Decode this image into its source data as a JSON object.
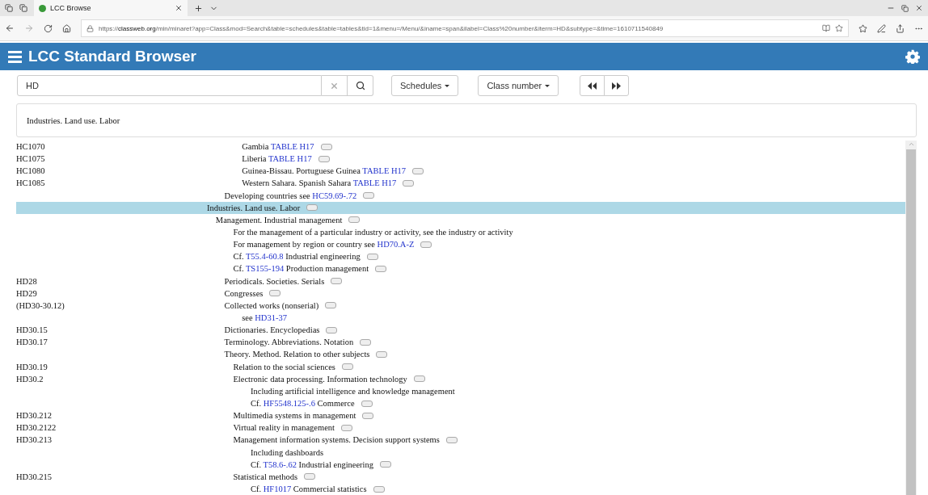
{
  "browser": {
    "tab_title": "LCC Browse",
    "url_prefix": "https://",
    "url_domain": "classweb.org",
    "url_rest": "/min/minaret?app=Class&mod=Search&table=schedules&table=tables&tid=1&menu=/Menu/&iname=span&ilabel=Class%20number&iterm=HD&subtype=&time=1610711540849"
  },
  "header": {
    "title": "LCC Standard Browser"
  },
  "search": {
    "value": "HD"
  },
  "dropdowns": [
    {
      "label": "Schedules"
    },
    {
      "label": "Class number"
    }
  ],
  "caption": "Industries. Land use. Labor",
  "entries": [
    {
      "children": [
        {
          "children": [
            {
              "children": [
                {
                  "children": [
                    {
                      "number": "HC1070",
                      "parts": [
                        {
                          "kind": "text",
                          "text": "Gambia "
                        },
                        {
                          "kind": "link",
                          "text": "TABLE H17"
                        }
                      ],
                      "note": true,
                      "selected": false
                    },
                    {
                      "number": "HC1075",
                      "parts": [
                        {
                          "kind": "text",
                          "text": "Liberia "
                        },
                        {
                          "kind": "link",
                          "text": "TABLE H17"
                        }
                      ],
                      "note": true,
                      "selected": false
                    },
                    {
                      "number": "HC1080",
                      "parts": [
                        {
                          "kind": "text",
                          "text": "Guinea-Bissau. Portuguese Guinea "
                        },
                        {
                          "kind": "link",
                          "text": "TABLE H17"
                        }
                      ],
                      "note": true,
                      "selected": false
                    },
                    {
                      "number": "HC1085",
                      "parts": [
                        {
                          "kind": "text",
                          "text": "Western Sahara. Spanish Sahara "
                        },
                        {
                          "kind": "link",
                          "text": "TABLE H17"
                        }
                      ],
                      "note": true,
                      "selected": false
                    }
                  ]
                }
              ]
            },
            {
              "parts": [
                {
                  "kind": "text",
                  "text": "Developing countries see "
                },
                {
                  "kind": "link",
                  "text": "HC59.69-.72"
                }
              ],
              "note": true,
              "selected": false
            }
          ]
        }
      ]
    },
    {
      "parts": [
        {
          "kind": "text",
          "text": "Industries. Land use. Labor"
        }
      ],
      "note": true,
      "selected": true,
      "children": [
        {
          "parts": [
            {
              "kind": "text",
              "text": "Management. Industrial management"
            }
          ],
          "note": true,
          "selected": false,
          "children": [
            {
              "children": [
                {
                  "parts": [
                    {
                      "kind": "text",
                      "text": "For the management of a particular industry or activity, see the industry or activity"
                    }
                  ],
                  "note": false,
                  "selected": false
                },
                {
                  "parts": [
                    {
                      "kind": "text",
                      "text": "For management by region or country see "
                    },
                    {
                      "kind": "link",
                      "text": "HD70.A-Z"
                    }
                  ],
                  "note": true,
                  "selected": false
                },
                {
                  "parts": [
                    {
                      "kind": "text",
                      "text": "Cf. "
                    },
                    {
                      "kind": "link",
                      "text": "T55.4-60.8"
                    },
                    {
                      "kind": "text",
                      "text": " Industrial engineering"
                    }
                  ],
                  "note": true,
                  "selected": false
                },
                {
                  "parts": [
                    {
                      "kind": "text",
                      "text": "Cf. "
                    },
                    {
                      "kind": "link",
                      "text": "TS155-194"
                    },
                    {
                      "kind": "text",
                      "text": " Production management"
                    }
                  ],
                  "note": true,
                  "selected": false
                }
              ]
            },
            {
              "number": "HD28",
              "parts": [
                {
                  "kind": "text",
                  "text": "Periodicals. Societies. Serials"
                }
              ],
              "note": true,
              "selected": false
            },
            {
              "number": "HD29",
              "parts": [
                {
                  "kind": "text",
                  "text": "Congresses"
                }
              ],
              "note": true,
              "selected": false
            },
            {
              "number": "(HD30-30.12)",
              "parts": [
                {
                  "kind": "text",
                  "text": "Collected works (nonserial)"
                }
              ],
              "note": true,
              "selected": false,
              "children": [
                {
                  "children": [
                    {
                      "parts": [
                        {
                          "kind": "text",
                          "text": "see "
                        },
                        {
                          "kind": "link",
                          "text": "HD31-37"
                        }
                      ],
                      "note": false,
                      "selected": false
                    }
                  ]
                }
              ]
            },
            {
              "number": "HD30.15",
              "parts": [
                {
                  "kind": "text",
                  "text": "Dictionaries. Encyclopedias"
                }
              ],
              "note": true,
              "selected": false
            },
            {
              "number": "HD30.17",
              "parts": [
                {
                  "kind": "text",
                  "text": "Terminology. Abbreviations. Notation"
                }
              ],
              "note": true,
              "selected": false
            },
            {
              "parts": [
                {
                  "kind": "text",
                  "text": "Theory. Method. Relation to other subjects"
                }
              ],
              "note": true,
              "selected": false,
              "children": [
                {
                  "number": "HD30.19",
                  "parts": [
                    {
                      "kind": "text",
                      "text": "Relation to the social sciences"
                    }
                  ],
                  "note": true,
                  "selected": false
                },
                {
                  "number": "HD30.2",
                  "parts": [
                    {
                      "kind": "text",
                      "text": "Electronic data processing. Information technology"
                    }
                  ],
                  "note": true,
                  "selected": false,
                  "children": [
                    {
                      "children": [
                        {
                          "parts": [
                            {
                              "kind": "text",
                              "text": "Including artificial intelligence and knowledge management"
                            }
                          ],
                          "note": false,
                          "selected": false
                        },
                        {
                          "parts": [
                            {
                              "kind": "text",
                              "text": "Cf. "
                            },
                            {
                              "kind": "link",
                              "text": "HF5548.125-.6"
                            },
                            {
                              "kind": "text",
                              "text": " Commerce"
                            }
                          ],
                          "note": true,
                          "selected": false
                        }
                      ]
                    }
                  ]
                },
                {
                  "number": "HD30.212",
                  "parts": [
                    {
                      "kind": "text",
                      "text": "Multimedia systems in management"
                    }
                  ],
                  "note": true,
                  "selected": false
                },
                {
                  "number": "HD30.2122",
                  "parts": [
                    {
                      "kind": "text",
                      "text": "Virtual reality in management"
                    }
                  ],
                  "note": true,
                  "selected": false
                },
                {
                  "number": "HD30.213",
                  "parts": [
                    {
                      "kind": "text",
                      "text": "Management information systems. Decision support systems"
                    }
                  ],
                  "note": true,
                  "selected": false,
                  "children": [
                    {
                      "children": [
                        {
                          "parts": [
                            {
                              "kind": "text",
                              "text": "Including dashboards"
                            }
                          ],
                          "note": false,
                          "selected": false
                        },
                        {
                          "parts": [
                            {
                              "kind": "text",
                              "text": "Cf. "
                            },
                            {
                              "kind": "link",
                              "text": "T58.6-.62"
                            },
                            {
                              "kind": "text",
                              "text": " Industrial engineering"
                            }
                          ],
                          "note": true,
                          "selected": false
                        }
                      ]
                    }
                  ]
                },
                {
                  "number": "HD30.215",
                  "parts": [
                    {
                      "kind": "text",
                      "text": "Statistical methods"
                    }
                  ],
                  "note": true,
                  "selected": false,
                  "children": [
                    {
                      "children": [
                        {
                          "parts": [
                            {
                              "kind": "text",
                              "text": "Cf. "
                            },
                            {
                              "kind": "link",
                              "text": "HF1017"
                            },
                            {
                              "kind": "text",
                              "text": " Commercial statistics"
                            }
                          ],
                          "note": true,
                          "selected": false
                        }
                      ]
                    }
                  ]
                }
              ]
            }
          ]
        }
      ]
    }
  ]
}
